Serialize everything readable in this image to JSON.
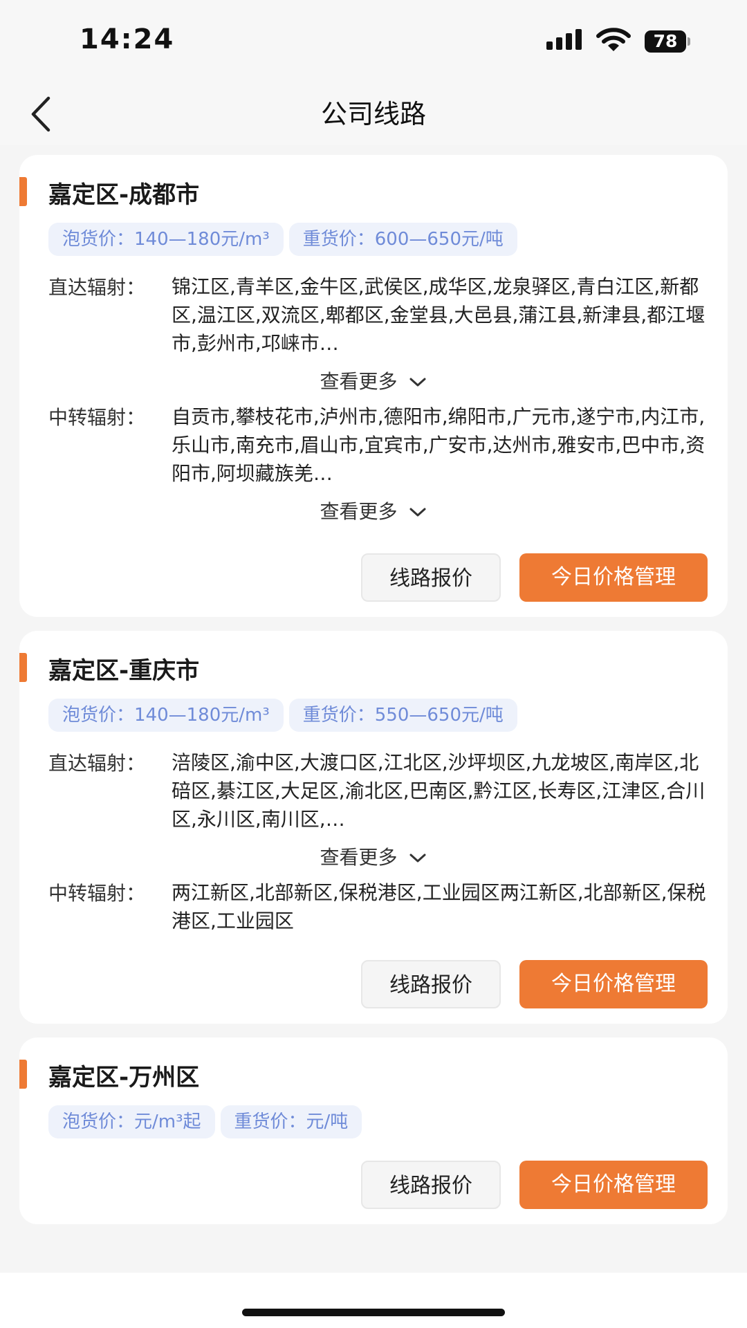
{
  "status": {
    "time": "14:24",
    "battery": "78"
  },
  "nav": {
    "title": "公司线路"
  },
  "cards": [
    {
      "title": "嘉定区-成都市",
      "light_price": "泡货价：140—180元/m³",
      "heavy_price": "重货价：600—650元/吨",
      "direct_label": "直达辐射：",
      "direct_text": "锦江区,青羊区,金牛区,武侯区,成华区,龙泉驿区,青白江区,新都区,温江区,双流区,郫都区,金堂县,大邑县,蒲江县,新津县,都江堰市,彭州市,邛崃市…",
      "more_label_1": "查看更多",
      "transfer_label": "中转辐射：",
      "transfer_text": "自贡市,攀枝花市,泸州市,德阳市,绵阳市,广元市,遂宁市,内江市,乐山市,南充市,眉山市,宜宾市,广安市,达州市,雅安市,巴中市,资阳市,阿坝藏族羌…",
      "more_label_2": "查看更多",
      "quote_button": "线路报价",
      "manage_button": "今日价格管理"
    },
    {
      "title": "嘉定区-重庆市",
      "light_price": "泡货价：140—180元/m³",
      "heavy_price": "重货价：550—650元/吨",
      "direct_label": "直达辐射：",
      "direct_text": "涪陵区,渝中区,大渡口区,江北区,沙坪坝区,九龙坡区,南岸区,北碚区,綦江区,大足区,渝北区,巴南区,黔江区,长寿区,江津区,合川区,永川区,南川区,…",
      "more_label_1": "查看更多",
      "transfer_label": "中转辐射：",
      "transfer_text": "两江新区,北部新区,保税港区,工业园区两江新区,北部新区,保税港区,工业园区",
      "quote_button": "线路报价",
      "manage_button": "今日价格管理"
    },
    {
      "title": "嘉定区-万州区",
      "light_price": "泡货价：元/m³起",
      "heavy_price": "重货价：元/吨",
      "quote_button": "线路报价",
      "manage_button": "今日价格管理"
    }
  ],
  "colors": {
    "accent": "#ee7a34",
    "tag_bg": "#eef2fb",
    "tag_text": "#6f8bd8"
  }
}
